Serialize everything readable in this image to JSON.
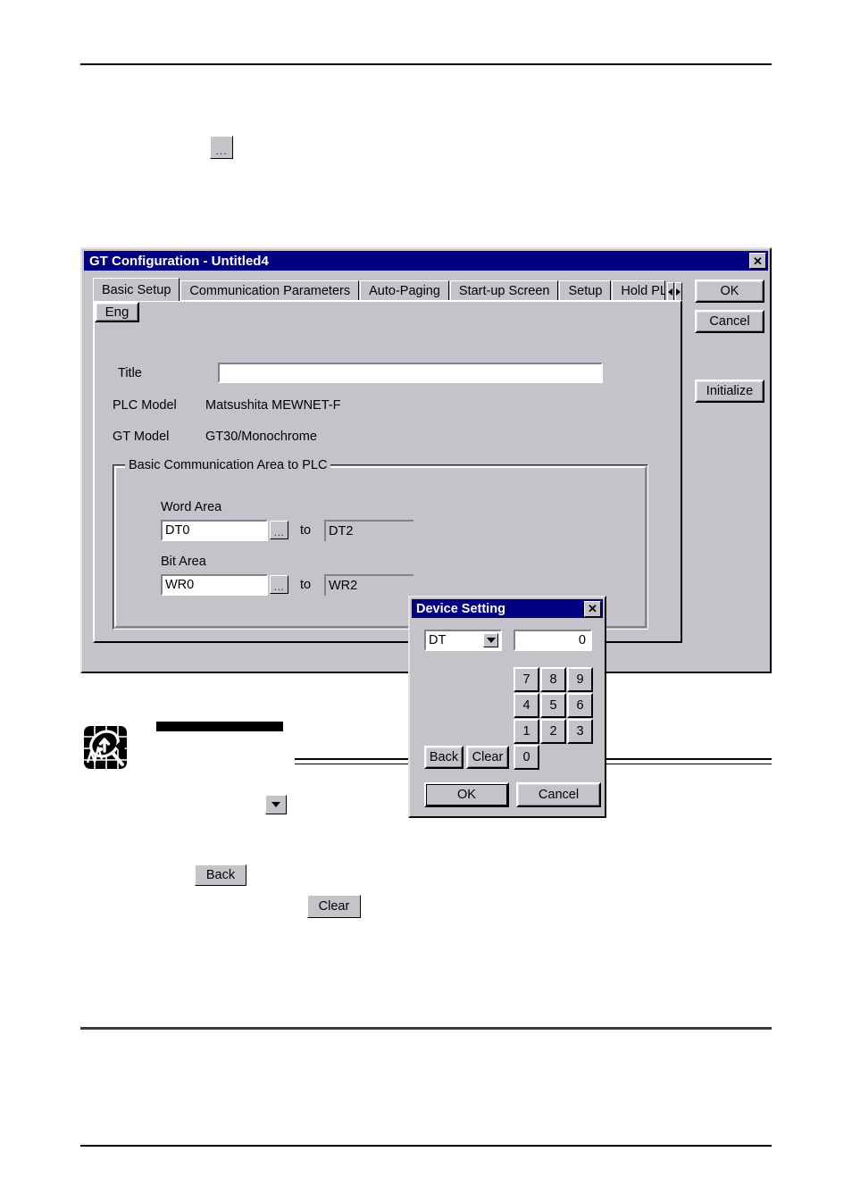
{
  "page": {
    "background": "#ffffff",
    "rules": {
      "header": true,
      "body_thick": true,
      "footer": true
    }
  },
  "standalone_controls": {
    "ellipsis_button_label": "...",
    "dropdown_button_label": "▼",
    "back_button_label": "Back",
    "clear_button_label": "Clear"
  },
  "note": {
    "icon_name": "magnifier-chart-icon",
    "bullet": "◆",
    "redacted_heading": "",
    "rule_count": 2
  },
  "gt_window": {
    "title": "GT Configuration - Untitled4",
    "titlebar_color": "#000080",
    "face_color": "#c6c2ca",
    "close_label": "✕",
    "tabs": [
      {
        "label": "Basic Setup",
        "active": true
      },
      {
        "label": "Communication Parameters",
        "active": false
      },
      {
        "label": "Auto-Paging",
        "active": false
      },
      {
        "label": "Start-up Screen",
        "active": false
      },
      {
        "label": "Setup",
        "active": false
      },
      {
        "label": "Hold PLC Devi",
        "active": false,
        "clipped": true
      }
    ],
    "tab_scroll": {
      "prev": "◄",
      "next": "►"
    },
    "basic_setup": {
      "title_label": "Title",
      "title_value": "",
      "eng_button_label": "Eng",
      "plc_model_label": "PLC Model",
      "plc_model_value": "Matsushita MEWNET-F",
      "gt_model_label": "GT Model",
      "gt_model_value": "GT30/Monochrome",
      "group_legend": "Basic Communication Area to PLC",
      "word_area": {
        "label": "Word Area",
        "start_value": "DT0",
        "browse_label": "...",
        "to_label": "to",
        "end_value": "DT2"
      },
      "bit_area": {
        "label": "Bit Area",
        "start_value": "WR0",
        "browse_label": "...",
        "to_label": "to",
        "end_value": "WR2"
      }
    },
    "buttons": {
      "ok": "OK",
      "cancel": "Cancel",
      "initialize": "Initialize"
    }
  },
  "device_setting_dialog": {
    "title": "Device Setting",
    "close_label": "✕",
    "device_combo_value": "DT",
    "combo_arrow": "▼",
    "value_input": "0",
    "keypad": [
      [
        "7",
        "8",
        "9"
      ],
      [
        "4",
        "5",
        "6"
      ],
      [
        "1",
        "2",
        "3"
      ],
      [
        "0"
      ]
    ],
    "back_label": "Back",
    "clear_label": "Clear",
    "ok_label": "OK",
    "cancel_label": "Cancel"
  }
}
